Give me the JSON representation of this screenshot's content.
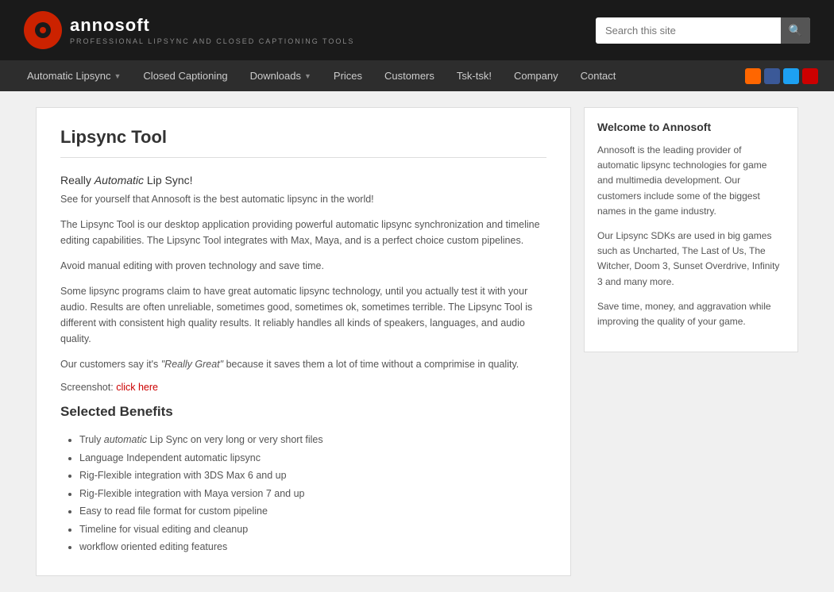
{
  "header": {
    "logo_text": "annosoft",
    "tagline": "PROFESSIONAL LIPSYNC AND CLOSED CAPTIONING TOOLS",
    "search_placeholder": "Search this site"
  },
  "nav": {
    "items": [
      {
        "label": "Automatic Lipsync",
        "has_arrow": true
      },
      {
        "label": "Closed Captioning",
        "has_arrow": false
      },
      {
        "label": "Downloads",
        "has_arrow": true
      },
      {
        "label": "Prices",
        "has_arrow": false
      },
      {
        "label": "Customers",
        "has_arrow": false
      },
      {
        "label": "Tsk-tsk!",
        "has_arrow": false
      },
      {
        "label": "Company",
        "has_arrow": false
      },
      {
        "label": "Contact",
        "has_arrow": false
      }
    ]
  },
  "main": {
    "title": "Lipsync Tool",
    "subtitle_plain": "Really ",
    "subtitle_italic": "Automatic",
    "subtitle_rest": " Lip Sync!",
    "intro": "See for yourself that Annosoft is the best automatic lipsync in the world!",
    "para1": "The Lipsync Tool is our desktop application providing powerful automatic lipsync synchronization and timeline editing capabilities. The Lipsync Tool integrates with Max, Maya, and is a perfect choice custom pipelines.",
    "para2": "Avoid manual editing with proven technology and save time.",
    "para3": "Some lipsync programs claim to have great automatic lipsync technology, until you actually test it with your audio. Results are often unreliable, sometimes good, sometimes ok, sometimes terrible. The Lipsync Tool is different with consistent high quality results. It reliably handles all kinds of speakers, languages, and audio quality.",
    "para4_start": "Our customers say it's ",
    "para4_quote": "\"Really Great\"",
    "para4_end": " because it saves them a lot of time without a comprimise in quality.",
    "screenshot_label": "Screenshot:",
    "screenshot_link": "click here",
    "benefits_title": "Selected Benefits",
    "benefits": [
      {
        "plain": "Truly ",
        "italic": "automatic",
        "rest": " Lip Sync on very long or very short files"
      },
      {
        "plain": "Language Independent automatic lipsync"
      },
      {
        "plain": "Rig-Flexible integration with 3DS Max 6 and up"
      },
      {
        "plain": "Rig-Flexible integration with Maya version 7 and up"
      },
      {
        "plain": "Easy to read file format for custom pipeline"
      },
      {
        "plain": "Timeline for visual editing and cleanup"
      },
      {
        "plain": "workflow oriented editing features"
      }
    ]
  },
  "sidebar": {
    "welcome_title": "Welcome to Annosoft",
    "para1": "Annosoft is the leading provider of automatic lipsync technologies for game and multimedia development. Our customers include some of the biggest names in the game industry.",
    "para2": "Our Lipsync SDKs are used in big games such as Uncharted, The Last of Us, The Witcher, Doom 3, Sunset Overdrive, Infinity 3 and many more.",
    "para3": "Save time, money, and aggravation while improving the quality of your game."
  }
}
